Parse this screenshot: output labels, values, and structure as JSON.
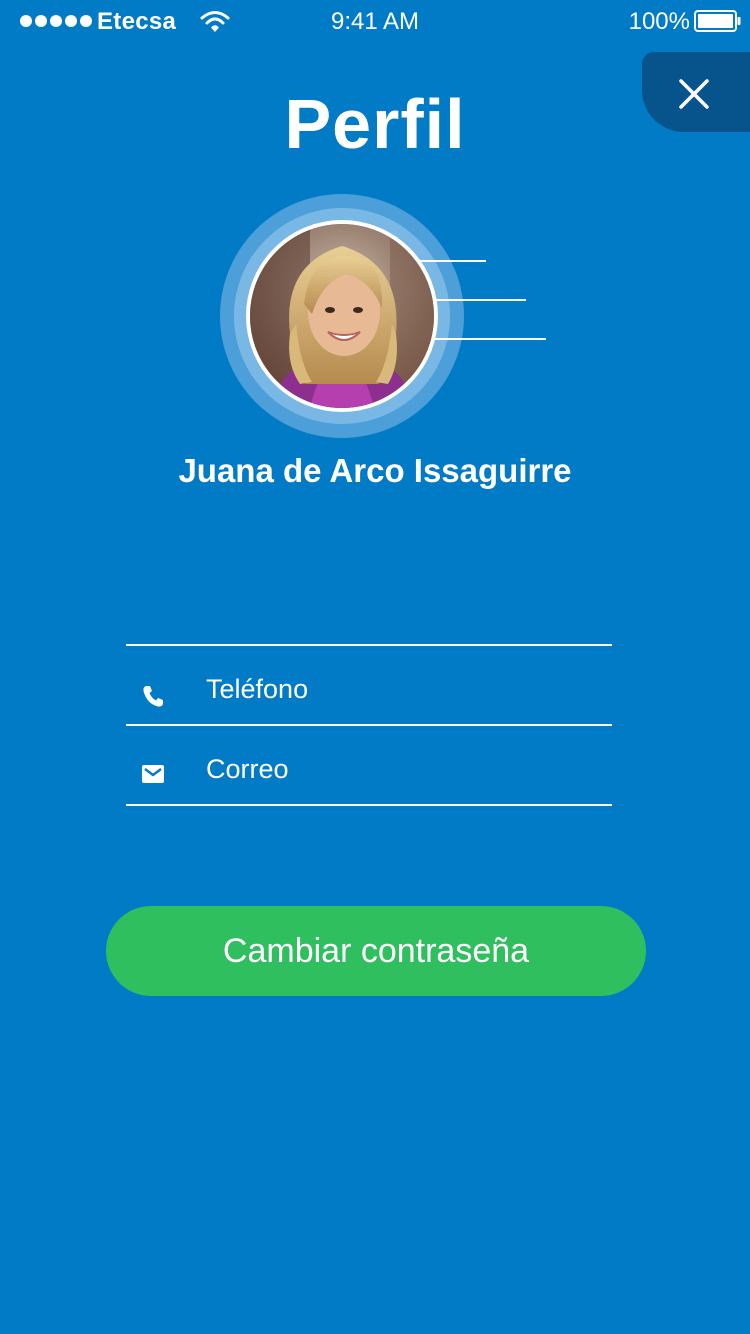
{
  "status_bar": {
    "carrier": "Etecsa",
    "time": "9:41 AM",
    "battery": "100%"
  },
  "header": {
    "title": "Perfil"
  },
  "profile": {
    "name": "Juana de Arco Issaguirre"
  },
  "form": {
    "phone_placeholder": "Teléfono",
    "email_placeholder": "Correo"
  },
  "actions": {
    "change_password_label": "Cambiar contraseña"
  },
  "colors": {
    "background": "#027BC6",
    "close_tab": "#07538B",
    "button": "#30BF5E"
  },
  "icons": {
    "close": "close-icon",
    "phone": "phone-icon",
    "email": "envelope-icon",
    "wifi": "wifi-icon",
    "battery": "battery-icon"
  }
}
